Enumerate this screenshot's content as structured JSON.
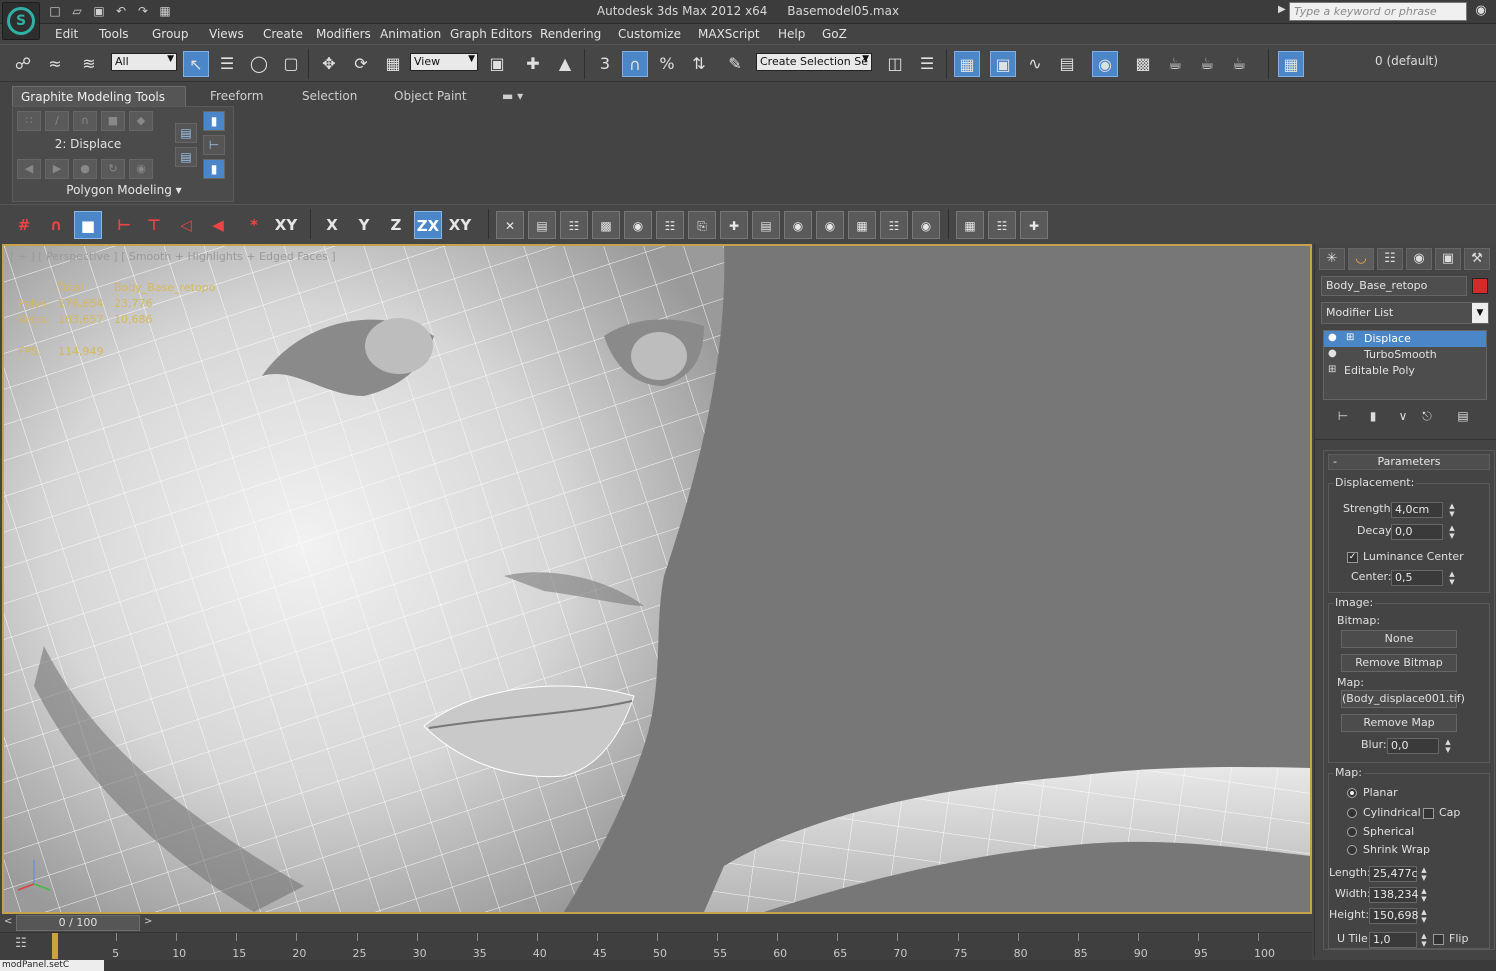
{
  "titlebar": {
    "app_name": "Autodesk 3ds Max  2012 x64",
    "file_name": "Basemodel05.max",
    "search_placeholder": "Type a keyword or phrase"
  },
  "menu": [
    "Edit",
    "Tools",
    "Group",
    "Views",
    "Create",
    "Modifiers",
    "Animation",
    "Graph Editors",
    "Rendering",
    "Customize",
    "MAXScript",
    "Help",
    "GoZ"
  ],
  "maintoolbar": {
    "selection_filter": "All",
    "ref_coord": "View",
    "named_selection_placeholder": "Create Selection Se",
    "layer": "0 (default)"
  },
  "ribbon": {
    "tabs": [
      "Graphite Modeling Tools",
      "Freeform",
      "Selection",
      "Object Paint"
    ],
    "panel_label": "2: Displace",
    "panel_footer": "Polygon Modeling"
  },
  "snaptoolbar": {
    "axis_x": "X",
    "axis_y": "Y",
    "axis_z": "Z",
    "axis_zx": "ZX",
    "axis_xy": "XY"
  },
  "viewport": {
    "label": "[ + ] [ Perspective ] [ Smooth + Highlights + Edged Faces ]",
    "stats": {
      "total_header": "Total",
      "object_header": "Body_Base_retopo",
      "polys_label": "Polys:",
      "polys_total": "276,654",
      "polys_object": "23,776",
      "verts_label": "Verts:",
      "verts_total": "163,657",
      "verts_object": "10,686",
      "fps_label": "FPS:",
      "fps_value": "114,949"
    }
  },
  "command_panel": {
    "object_name": "Body_Base_retopo",
    "object_color": "#d42a2a",
    "modifier_list": "Modifier List",
    "stack": [
      "Displace",
      "TurboSmooth",
      "Editable Poly"
    ],
    "rollout_title": "Parameters",
    "displacement": {
      "title": "Displacement:",
      "strength_label": "Strength:",
      "strength": "4,0cm",
      "decay_label": "Decay:",
      "decay": "0,0",
      "luminance_label": "Luminance Center",
      "center_label": "Center:",
      "center": "0,5"
    },
    "image": {
      "title": "Image:",
      "bitmap_label": "Bitmap:",
      "bitmap_btn": "None",
      "remove_bitmap": "Remove Bitmap",
      "map_label": "Map:",
      "map_btn": "(Body_displace001.tif)",
      "remove_map": "Remove Map",
      "blur_label": "Blur:",
      "blur": "0,0"
    },
    "map": {
      "title": "Map:",
      "planar": "Planar",
      "cylindrical": "Cylindrical",
      "cap": "Cap",
      "spherical": "Spherical",
      "shrinkwrap": "Shrink Wrap",
      "length_label": "Length:",
      "length": "25,477c",
      "width_label": "Width:",
      "width": "138,234",
      "height_label": "Height:",
      "height": "150,698",
      "utile_label": "U Tile:",
      "utile": "1,0",
      "flip": "Flip"
    }
  },
  "timeline": {
    "frame_display": "0 / 100",
    "ticks": [
      "5",
      "10",
      "15",
      "20",
      "25",
      "30",
      "35",
      "40",
      "45",
      "50",
      "55",
      "60",
      "65",
      "70",
      "75",
      "80",
      "85",
      "90",
      "95",
      "100"
    ]
  },
  "status": {
    "maxscript_field": "modPanel.setC"
  }
}
